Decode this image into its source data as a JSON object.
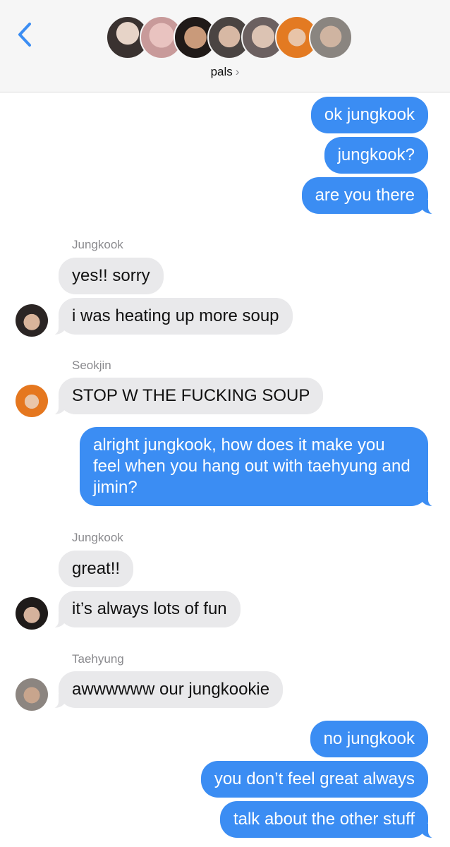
{
  "header": {
    "group_name": "pals",
    "chevron": "›",
    "back_icon": "chevron-left-icon",
    "accent": "#3b8df3"
  },
  "messages": [
    {
      "dir": "out",
      "text": "ok jungkook"
    },
    {
      "dir": "out",
      "text": "jungkook?"
    },
    {
      "dir": "out",
      "text": "are you there"
    },
    {
      "dir": "sender",
      "text": "Jungkook"
    },
    {
      "dir": "in",
      "text": "yes!! sorry"
    },
    {
      "dir": "in",
      "text": "i was heating up more soup"
    },
    {
      "dir": "sender",
      "text": "Seokjin"
    },
    {
      "dir": "in",
      "text": "STOP W THE FUCKING SOUP"
    },
    {
      "dir": "out",
      "text": "alright jungkook, how does it make you feel when you hang out with taehyung and jimin?"
    },
    {
      "dir": "sender",
      "text": "Jungkook"
    },
    {
      "dir": "in",
      "text": "great!!"
    },
    {
      "dir": "in",
      "text": "it’s always lots of fun"
    },
    {
      "dir": "sender",
      "text": "Taehyung"
    },
    {
      "dir": "in",
      "text": "awwwwww our jungkookie"
    },
    {
      "dir": "out",
      "text": "no jungkook"
    },
    {
      "dir": "out",
      "text": "you don’t feel great always"
    },
    {
      "dir": "out",
      "text": "talk about the other stuff"
    }
  ],
  "colors": {
    "outgoing_bubble": "#3b8df3",
    "incoming_bubble": "#e9e9eb",
    "header_bg": "#f6f6f6",
    "sender_name": "#8a8a8e"
  }
}
